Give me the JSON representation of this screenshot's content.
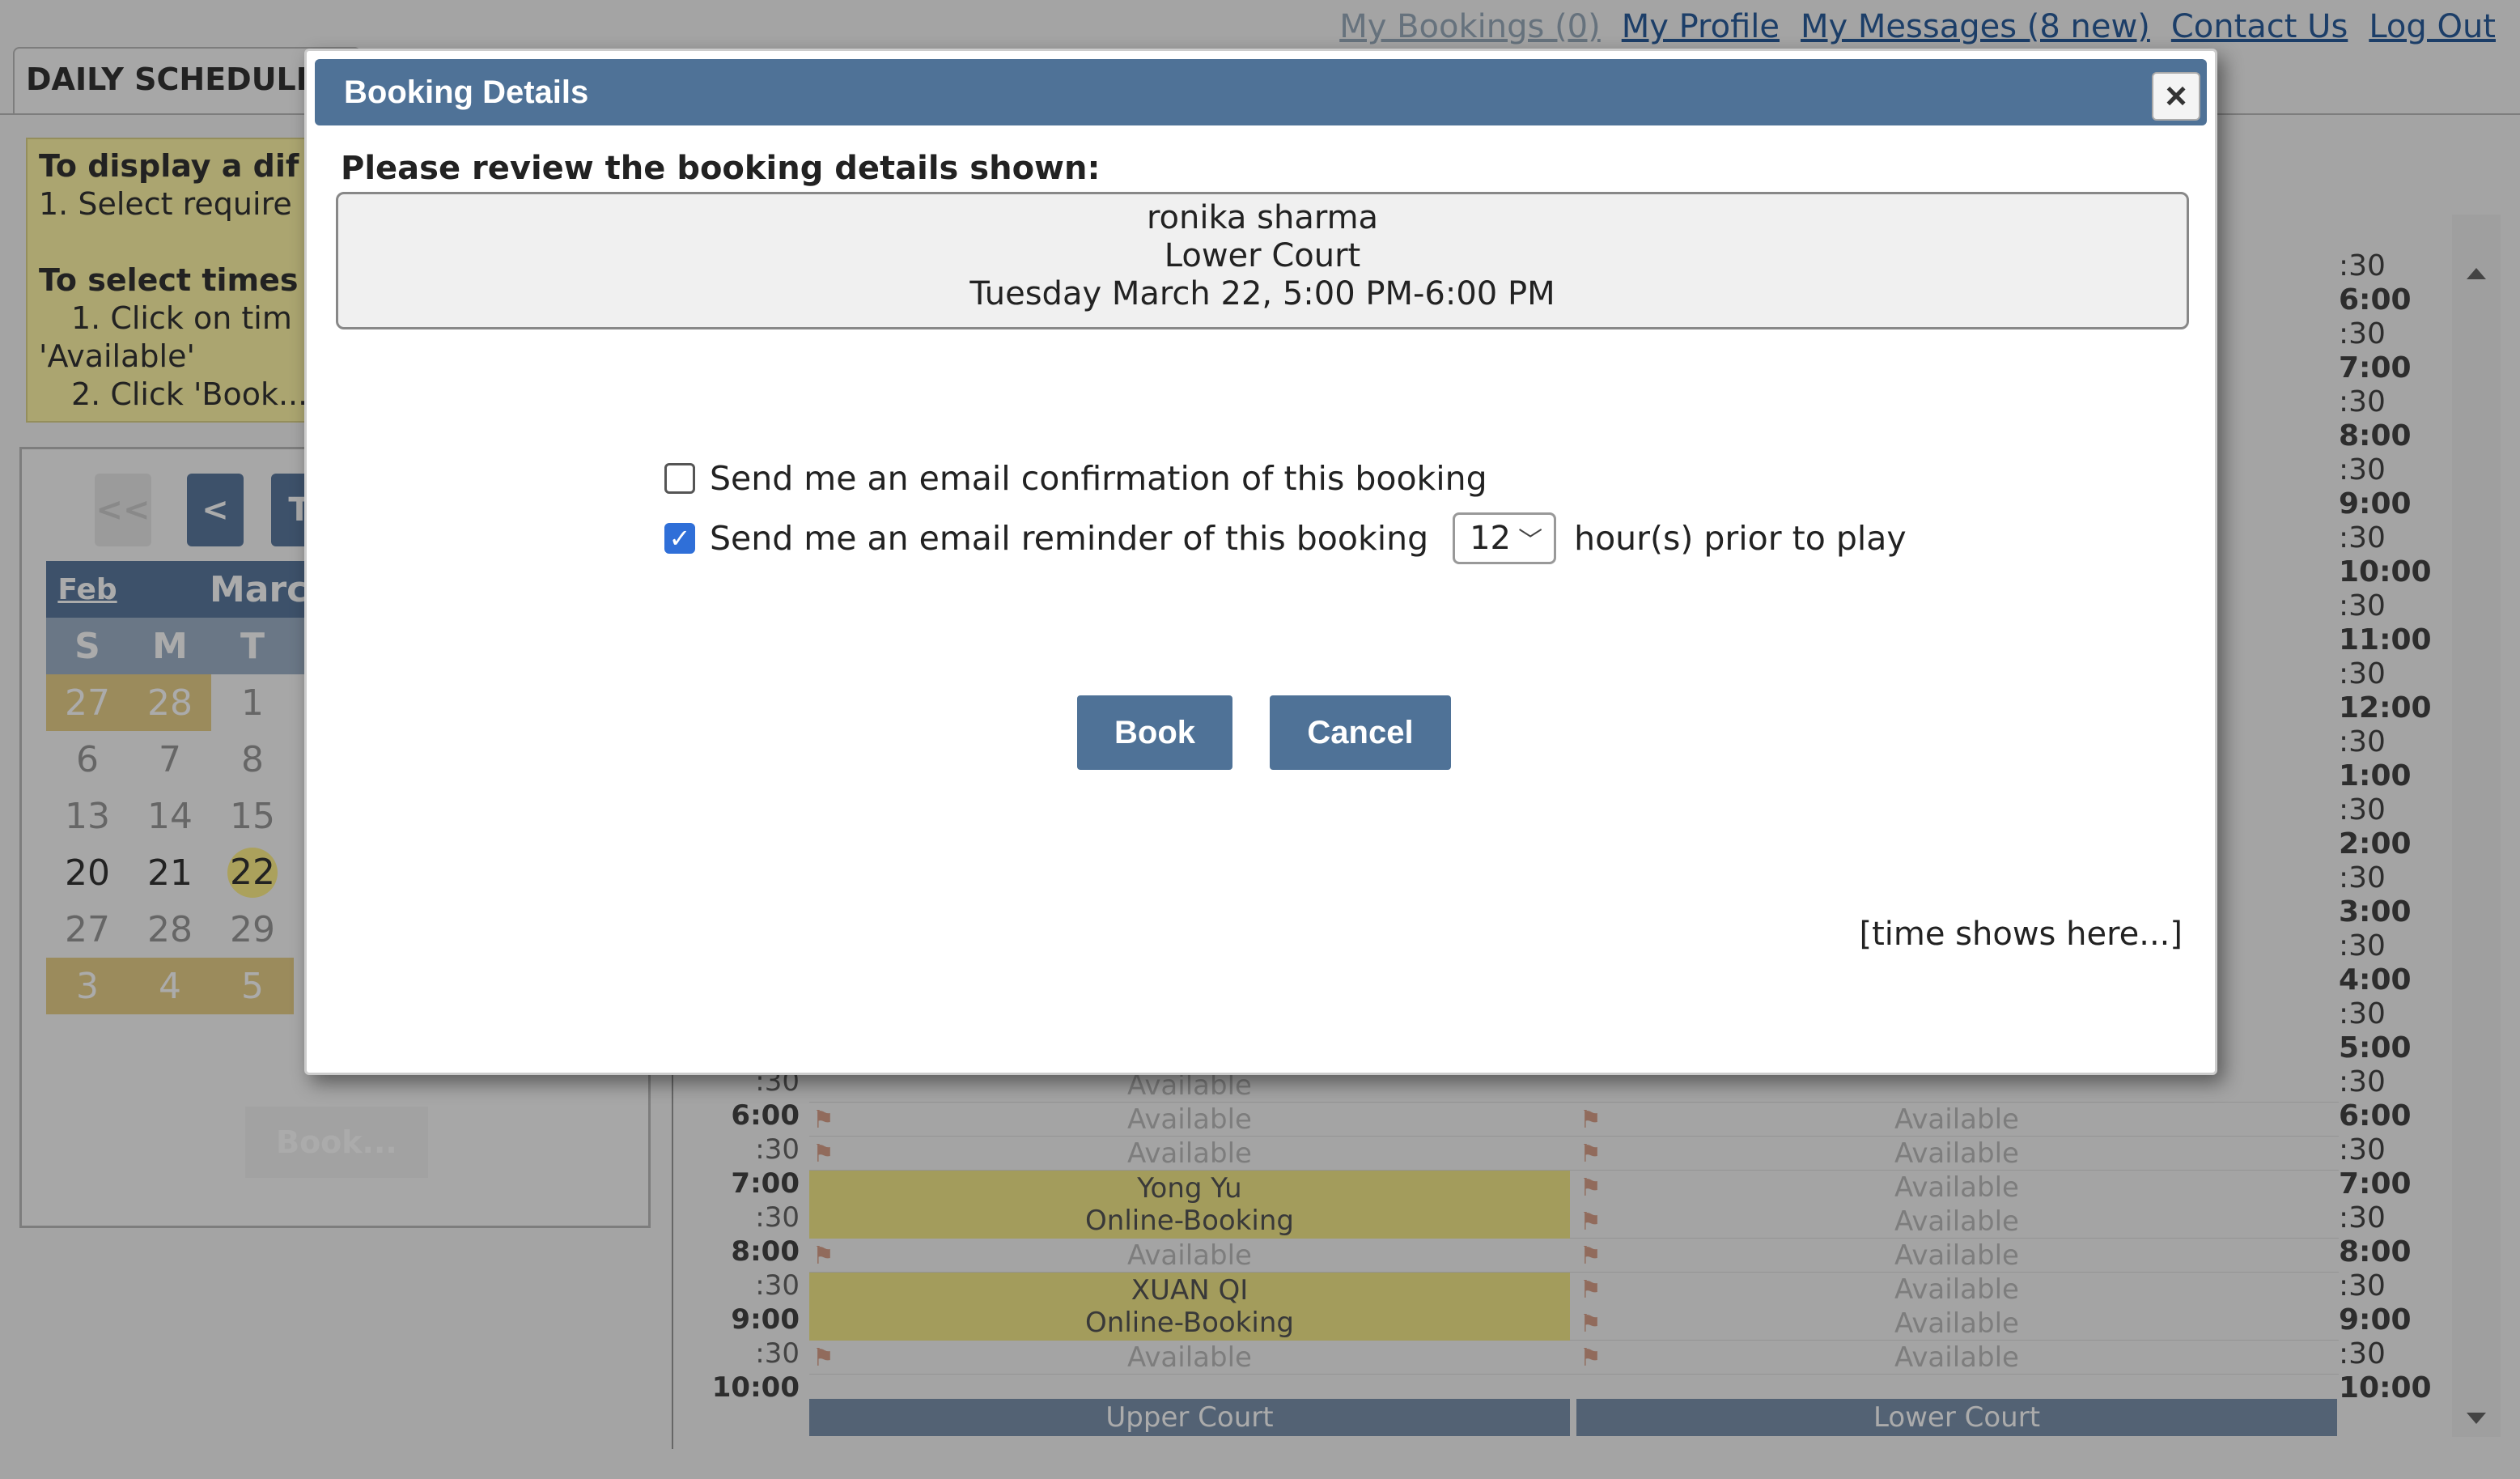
{
  "top_links": [
    "My Bookings (0)",
    "My Profile",
    "My Messages (8 new)",
    "Contact Us",
    "Log Out"
  ],
  "tab": {
    "label": "DAILY SCHEDULE"
  },
  "help": {
    "line1": "To display a dif",
    "line2": "1. Select require",
    "line3": "To select times",
    "line4": "1. Click on tim",
    "line5": "'Available'",
    "line6": "2. Click 'Book..."
  },
  "calendar": {
    "nav_first": "<<",
    "nav_prev": "<",
    "nav_today": "T",
    "prev_month": "Feb",
    "month": "Marc",
    "dow": [
      "S",
      "M",
      "T"
    ],
    "weeks": [
      [
        "27",
        "28",
        "1"
      ],
      [
        "6",
        "7",
        "8"
      ],
      [
        "13",
        "14",
        "15"
      ],
      [
        "20",
        "21",
        "22"
      ],
      [
        "27",
        "28",
        "29"
      ],
      [
        "3",
        "4",
        "5"
      ]
    ],
    "book_label": "Book..."
  },
  "schedule": {
    "available": "Available",
    "booking1": {
      "name": "Yong Yu",
      "type": "Online-Booking"
    },
    "booking2": {
      "name": "XUAN QI",
      "type": "Online-Booking"
    },
    "court1": "Upper Court",
    "court2": "Lower Court",
    "left_times": [
      ":30",
      "6:00",
      ":30",
      "7:00",
      ":30",
      "8:00",
      ":30",
      "9:00",
      ":30",
      "10:00"
    ],
    "right_times": [
      ":30",
      "6:00",
      ":30",
      "7:00",
      ":30",
      "8:00",
      ":30",
      "9:00",
      ":30",
      "10:00",
      ":30",
      "11:00",
      ":30",
      "12:00",
      ":30",
      "1:00",
      ":30",
      "2:00",
      ":30",
      "3:00",
      ":30",
      "4:00",
      ":30",
      "5:00",
      ":30",
      "6:00",
      ":30",
      "7:00",
      ":30",
      "8:00",
      ":30",
      "9:00",
      ":30",
      "10:00"
    ]
  },
  "dialog": {
    "title": "Booking Details",
    "close_label": "×",
    "prompt": "Please review the booking details shown:",
    "name": "ronika sharma",
    "court": "Lower Court",
    "when": "Tuesday March 22, 5:00 PM-6:00 PM",
    "confirm_label": "Send me an email confirmation of this booking",
    "confirm_checked": false,
    "reminder_label": "Send me an email reminder of this booking",
    "reminder_checked": true,
    "reminder_hours": "12",
    "reminder_suffix": "hour(s) prior to play",
    "book_label": "Book",
    "cancel_label": "Cancel",
    "time_note": "[time shows here...]"
  }
}
